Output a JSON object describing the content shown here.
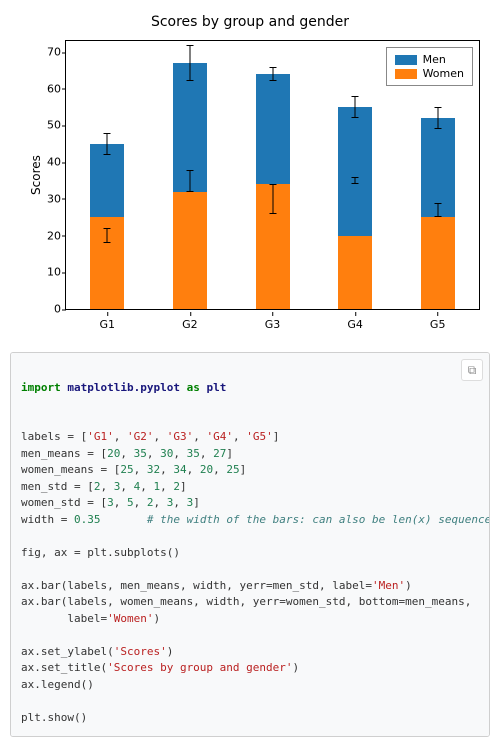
{
  "chart_data": {
    "type": "bar",
    "stacked": true,
    "categories": [
      "G1",
      "G2",
      "G3",
      "G4",
      "G5"
    ],
    "series": [
      {
        "name": "Men",
        "values": [
          20,
          35,
          30,
          35,
          27
        ],
        "err": [
          2,
          3,
          4,
          1,
          2
        ],
        "color": "#1f77b4"
      },
      {
        "name": "Women",
        "values": [
          25,
          32,
          34,
          20,
          25
        ],
        "err": [
          3,
          5,
          2,
          3,
          3
        ],
        "color": "#ff7f0e"
      }
    ],
    "title": "Scores by group and gender",
    "ylabel": "Scores",
    "xlabel": "",
    "ylim": [
      0,
      73
    ],
    "yticks": [
      0,
      10,
      20,
      30,
      40,
      50,
      60,
      70
    ],
    "legend_position": "upper right"
  },
  "legend": {
    "men": "Men",
    "women": "Women"
  },
  "code": {
    "import": "import",
    "module": "matplotlib.pyplot",
    "as": "as",
    "alias": "plt",
    "labels_lhs": "labels = [",
    "g1": "'G1'",
    "g2": "'G2'",
    "g3": "'G3'",
    "g4": "'G4'",
    "g5": "'G5'",
    "rb": "]",
    "men_means_lhs": "men_means = [",
    "mm1": "20",
    "mm2": "35",
    "mm3": "30",
    "mm4": "35",
    "mm5": "27",
    "women_means_lhs": "women_means = [",
    "wm1": "25",
    "wm2": "32",
    "wm3": "34",
    "wm4": "20",
    "wm5": "25",
    "men_std_lhs": "men_std = [",
    "ms1": "2",
    "ms2": "3",
    "ms3": "4",
    "ms4": "1",
    "ms5": "2",
    "women_std_lhs": "women_std = [",
    "ws1": "3",
    "ws2": "5",
    "ws3": "2",
    "ws4": "3",
    "ws5": "3",
    "width_lhs": "width = ",
    "width_val": "0.35",
    "width_comment": "# the width of the bars: can also be len(x) sequence",
    "subplot": "fig, ax = plt.subplots()",
    "bar1": "ax.bar(labels, men_means, width, yerr=men_std, label=",
    "bar1_lbl": "'Men'",
    "paren": ")",
    "bar2a": "ax.bar(labels, women_means, width, yerr=women_std, bottom=men_means,",
    "bar2b": "       label=",
    "bar2_lbl": "'Women'",
    "setyl": "ax.set_ylabel(",
    "yl_str": "'Scores'",
    "settl": "ax.set_title(",
    "tl_str": "'Scores by group and gender'",
    "leg": "ax.legend()",
    "show": "plt.show()"
  },
  "copy_icon": "⧉"
}
